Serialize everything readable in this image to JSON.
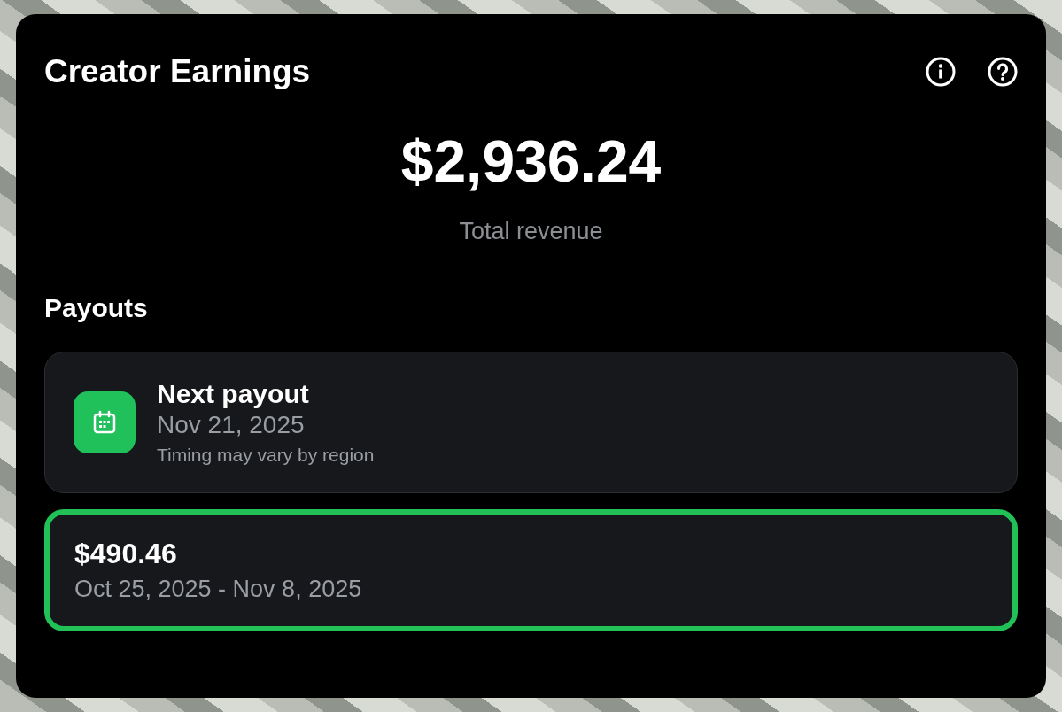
{
  "title": "Creator Earnings",
  "total": {
    "amount": "$2,936.24",
    "label": "Total revenue"
  },
  "payouts": {
    "heading": "Payouts",
    "next": {
      "title": "Next payout",
      "date": "Nov 21, 2025",
      "note": "Timing may vary by region"
    },
    "items": [
      {
        "amount": "$490.46",
        "period": "Oct 25, 2025 - Nov 8, 2025",
        "highlighted": true
      }
    ]
  }
}
